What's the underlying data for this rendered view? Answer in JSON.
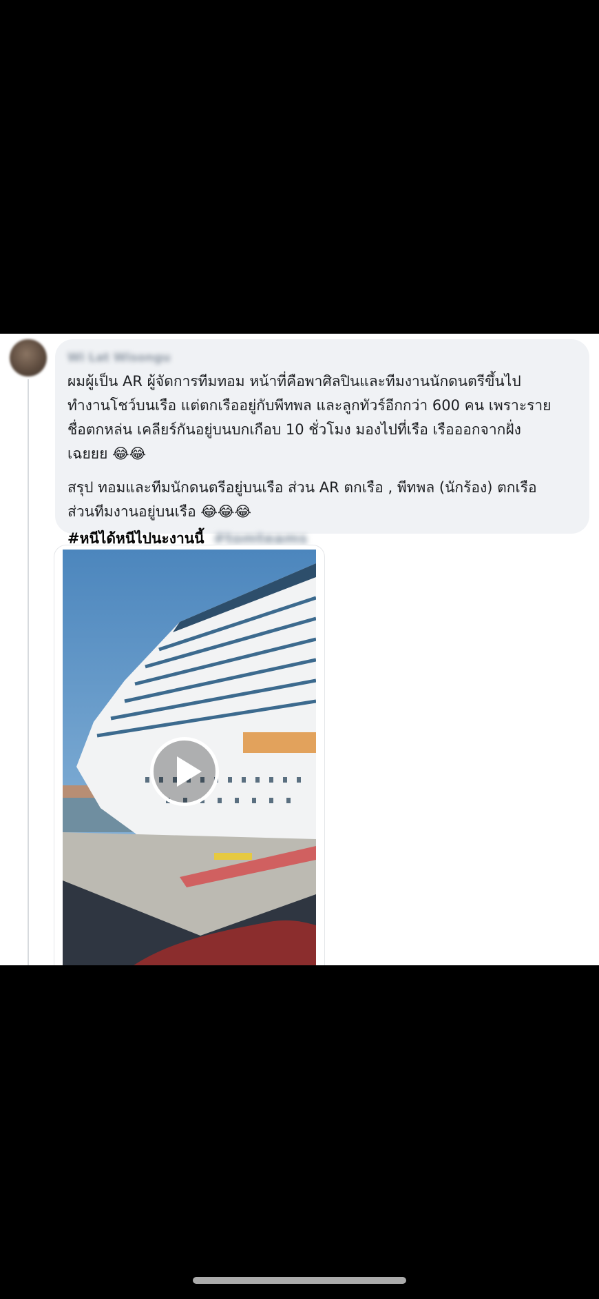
{
  "post": {
    "author_name": "Wi Lat Wisongu",
    "paragraph_1": "ผมผู้เป็น AR ผู้จัดการทีมทอม หน้าที่คือพาศิลปินและทีมงานนักดนตรีขึ้นไป\nทำงานโชว์บนเรือ แต่ตกเรืออยู่กับพีทพล และลูกทัวร์อีกกว่า 600 คน เพราะราย\nชื่อตกหล่น เคลียร์กันอยู่บนบกเกือบ 10 ชั่วโมง มองไปที่เรือ เรือออกจากฝั่ง\nเฉยยย 😂😂",
    "paragraph_2": "สรุป ทอมและทีมนักดนตรีอยู่บนเรือ ส่วน AR ตกเรือ , พีทพล (นักร้อง) ตกเรือ\nส่วนทีมงานอยู่บนเรือ 😂😂😂",
    "hashtag_1": "#หนีได้หนีไปนะงานนี้",
    "hashtag_2": "#tomteams",
    "media": {
      "type": "video",
      "play_icon": "play-icon"
    }
  },
  "colors": {
    "background": "#000000",
    "bubble": "#f0f2f5",
    "text": "#1c1e21"
  }
}
